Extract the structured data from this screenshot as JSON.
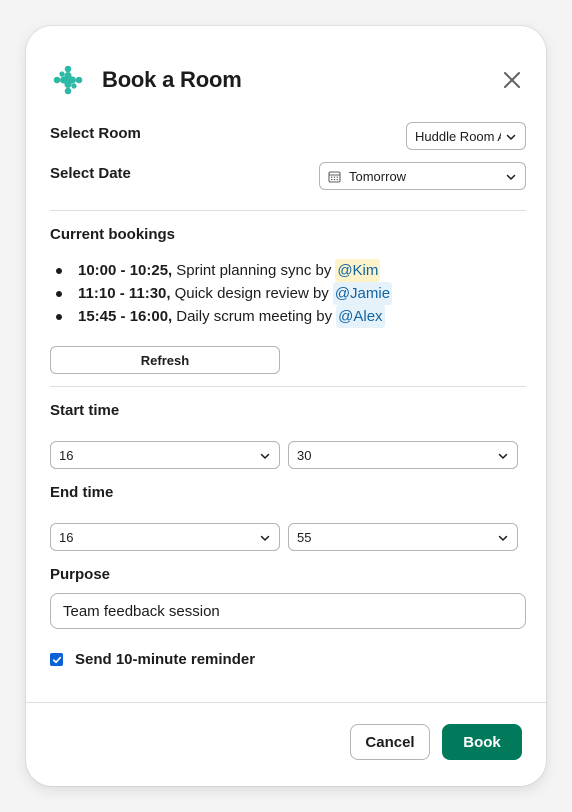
{
  "dialog": {
    "title": "Book a Room",
    "icons": {
      "logo": "slack-app-icon",
      "close": "close-icon"
    }
  },
  "room": {
    "label": "Select Room",
    "value": "Huddle Room A"
  },
  "date": {
    "label": "Select Date",
    "value": "Tomorrow"
  },
  "bookings": {
    "heading": "Current bookings",
    "items": [
      {
        "time": "10:00 - 10:25,",
        "desc": "Sprint planning sync by",
        "mention": "@Kim",
        "highlight": true
      },
      {
        "time": "11:10 - 11:30,",
        "desc": "Quick design review by",
        "mention": "@Jamie",
        "highlight": false
      },
      {
        "time": "15:45 - 16:00,",
        "desc": "Daily scrum meeting by",
        "mention": "@Alex",
        "highlight": false
      }
    ],
    "refresh_label": "Refresh"
  },
  "start": {
    "label": "Start time",
    "hour": "16",
    "minute": "30"
  },
  "end": {
    "label": "End time",
    "hour": "16",
    "minute": "55"
  },
  "purpose": {
    "label": "Purpose",
    "value": "Team feedback session"
  },
  "reminder": {
    "label": "Send 10-minute reminder",
    "checked": true
  },
  "footer": {
    "cancel_label": "Cancel",
    "book_label": "Book"
  },
  "colors": {
    "primary": "#007a5a",
    "mention_text": "#1264a3",
    "mention_bg": "#e6f2fa",
    "mention_highlight": "#fdf3c8",
    "checkbox": "#0b61d8",
    "logo": "#2eb8a6"
  }
}
